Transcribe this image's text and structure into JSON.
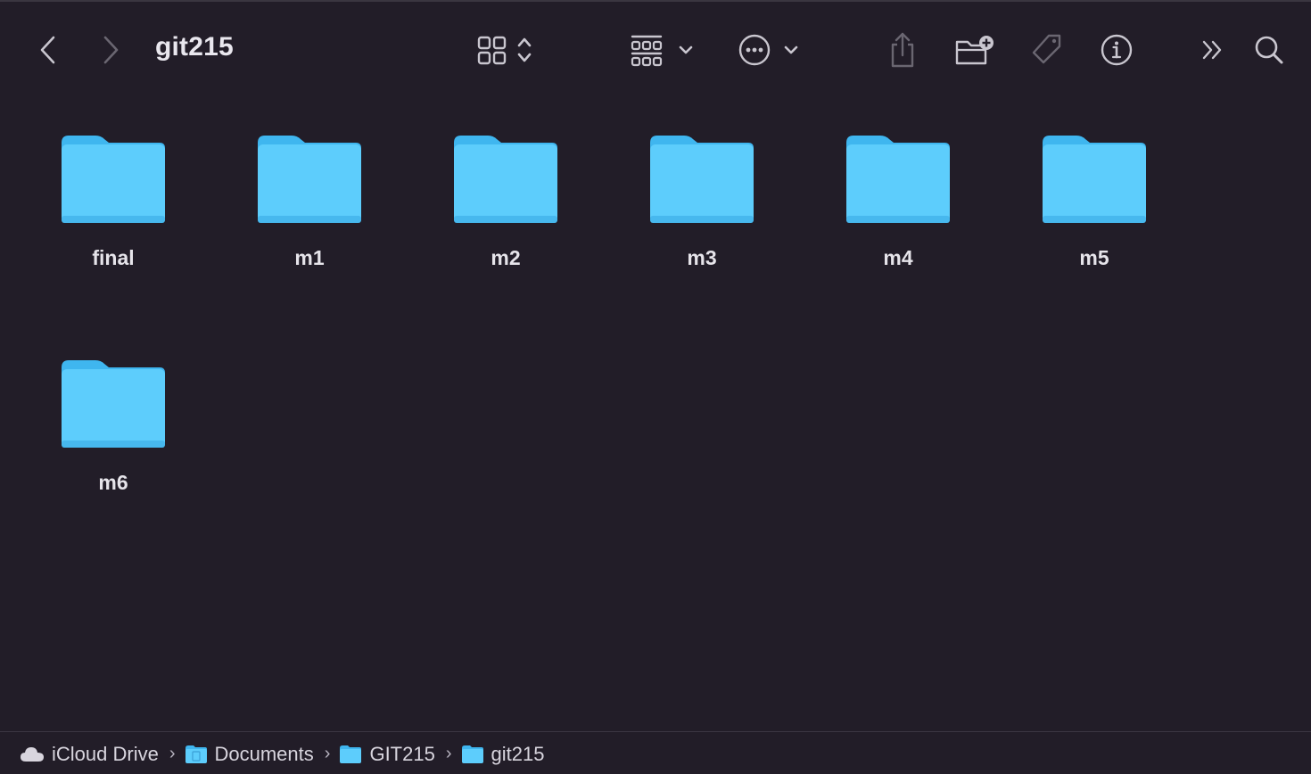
{
  "window": {
    "title": "git215"
  },
  "toolbar": {
    "icons": {
      "back": "chevron-left-icon",
      "forward": "chevron-right-icon",
      "view": "icon-view-grid-icon",
      "group": "group-by-icon",
      "action": "ellipsis-circle-icon",
      "share": "share-icon",
      "new_folder": "new-folder-icon",
      "tag": "tag-icon",
      "info": "info-icon",
      "overflow": "double-chevron-right-icon",
      "search": "search-icon"
    }
  },
  "colors": {
    "background": "#221d28",
    "folder_main": "#5dcdfc",
    "folder_tab": "#3fb6ef",
    "text": "#e6e4ea",
    "icon": "#c9c6cf"
  },
  "items": [
    {
      "name": "final"
    },
    {
      "name": "m1"
    },
    {
      "name": "m2"
    },
    {
      "name": "m3"
    },
    {
      "name": "m4"
    },
    {
      "name": "m5"
    },
    {
      "name": "m6"
    }
  ],
  "pathbar": {
    "crumbs": [
      {
        "label": "iCloud Drive",
        "icon": "cloud-icon"
      },
      {
        "label": "Documents",
        "icon": "documents-folder-icon"
      },
      {
        "label": "GIT215",
        "icon": "folder-icon"
      },
      {
        "label": "git215",
        "icon": "folder-icon"
      }
    ]
  }
}
